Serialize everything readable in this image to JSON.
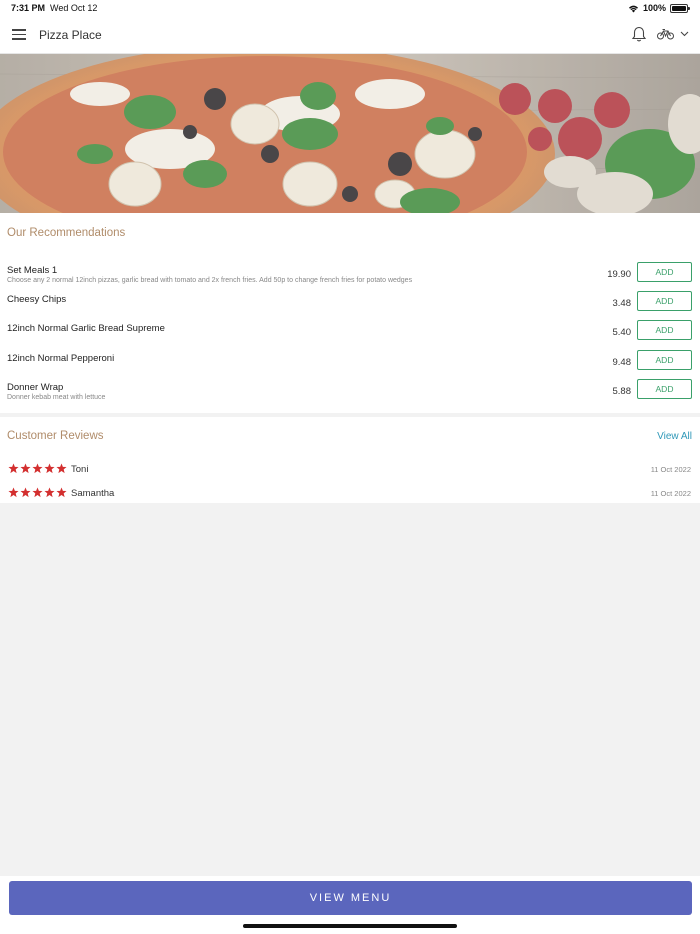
{
  "status_bar": {
    "time": "7:31 PM",
    "date": "Wed Oct 12",
    "battery": "100%"
  },
  "header": {
    "title": "Pizza Place",
    "menu_icon": "hamburger-icon",
    "notification_icon": "bell-icon",
    "delivery_icon": "bicycle-icon"
  },
  "recommendations": {
    "title": "Our Recommendations",
    "add_label": "ADD",
    "items": [
      {
        "name": "Set Meals 1",
        "description": "Choose any 2 normal 12inch pizzas, garlic bread with tomato and 2x french fries. Add 50p to change french fries for potato wedges",
        "price": "19.90"
      },
      {
        "name": "Cheesy Chips",
        "description": "",
        "price": "3.48"
      },
      {
        "name": "12inch Normal Garlic Bread Supreme",
        "description": "",
        "price": "5.40"
      },
      {
        "name": "12inch Normal Pepperoni",
        "description": "",
        "price": "9.48"
      },
      {
        "name": "Donner Wrap",
        "description": "Donner kebab meat with lettuce",
        "price": "5.88"
      }
    ]
  },
  "reviews": {
    "title": "Customer Reviews",
    "view_all": "View All",
    "items": [
      {
        "name": "Toni",
        "date": "11 Oct 2022",
        "rating": 5
      },
      {
        "name": "Samantha",
        "date": "11 Oct 2022",
        "rating": 5
      }
    ]
  },
  "footer": {
    "view_menu_label": "VIEW MENU"
  },
  "colors": {
    "accent": "#5b66bd",
    "add_green": "#3aa06a",
    "section_title": "#b08c6a",
    "star_red": "#d32f2f",
    "link": "#2f98b8"
  }
}
